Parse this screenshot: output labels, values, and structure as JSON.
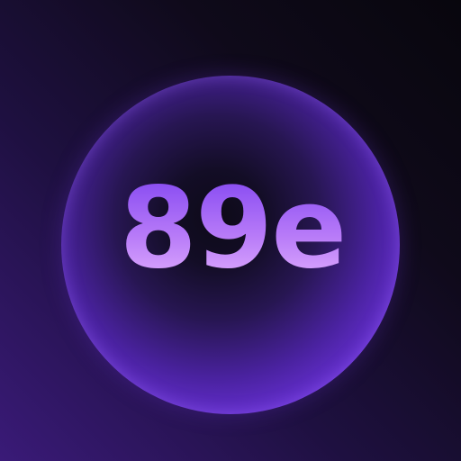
{
  "logo": {
    "text": "89e"
  },
  "colors": {
    "background_dark": "#08060d",
    "background_purple": "#3a1a78",
    "orb_center": "#0d0a18",
    "orb_edge": "#8a4cf6",
    "text_top": "#7b3ff0",
    "text_bottom": "#e8b8ff"
  }
}
